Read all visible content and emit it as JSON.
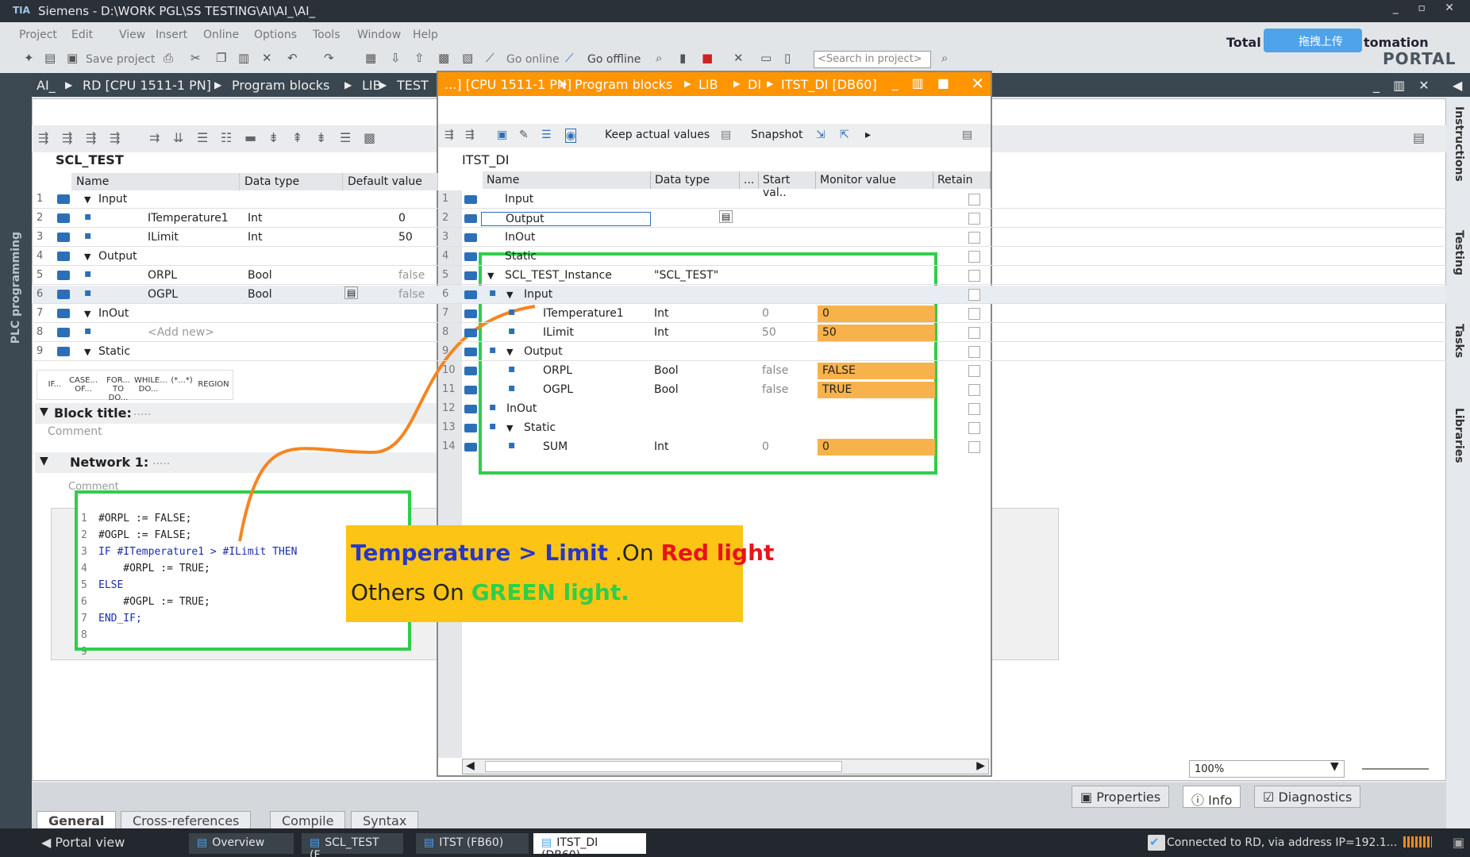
{
  "app": {
    "title": "Siemens  -  D:\\WORK PGL\\SS TESTING\\AI\\AI_\\AI_",
    "logo": "TIA"
  },
  "menu": [
    "Project",
    "Edit",
    "View",
    "Insert",
    "Online",
    "Options",
    "Tools",
    "Window",
    "Help"
  ],
  "toolbar": {
    "save_label": "Save project",
    "go_online": "Go online",
    "go_offline": "Go offline",
    "search_placeholder": "<Search in project>"
  },
  "brand": {
    "total": "Total",
    "portal": "PORTAL",
    "automation": "tomation",
    "upload": "拖拽上传"
  },
  "crumb": [
    "AI_",
    "RD [CPU 1511-1 PN]",
    "Program blocks",
    "LIB",
    "TEST"
  ],
  "plc_label": "PLC programming",
  "block": {
    "name": "SCL_TEST",
    "headers": [
      "Name",
      "Data type",
      "Default value"
    ],
    "rows": [
      {
        "no": "1",
        "name": "Input",
        "type": "",
        "val": "",
        "exp": true,
        "lvl": 0
      },
      {
        "no": "2",
        "name": "ITemperature1",
        "type": "Int",
        "val": "0",
        "lvl": 1
      },
      {
        "no": "3",
        "name": "ILimit",
        "type": "Int",
        "val": "50",
        "lvl": 1
      },
      {
        "no": "4",
        "name": "Output",
        "type": "",
        "val": "",
        "exp": true,
        "lvl": 0
      },
      {
        "no": "5",
        "name": "ORPL",
        "type": "Bool",
        "val": "false",
        "lvl": 1
      },
      {
        "no": "6",
        "name": "OGPL",
        "type": "Bool",
        "val": "false",
        "lvl": 1
      },
      {
        "no": "7",
        "name": "InOut",
        "type": "",
        "val": "",
        "exp": true,
        "lvl": 0
      },
      {
        "no": "8",
        "name": "<Add new>",
        "type": "",
        "val": "",
        "lvl": 1
      },
      {
        "no": "9",
        "name": "Static",
        "type": "",
        "val": "",
        "exp": true,
        "lvl": 0
      }
    ]
  },
  "scl_tools": [
    "IF...",
    "CASE... OF...",
    "FOR... TO DO...",
    "WHILE... DO...",
    "(*...*)",
    "REGION"
  ],
  "block_title": "Block title:",
  "comment": "Comment",
  "network": "Network 1:",
  "dots": ".....",
  "code": [
    [
      "1",
      "#ORPL := FALSE;"
    ],
    [
      "2",
      "#OGPL := FALSE;"
    ],
    [
      "3",
      "IF #ITemperature1 > #ILimit THEN"
    ],
    [
      "4",
      "    #ORPL := TRUE;"
    ],
    [
      "5",
      "ELSE"
    ],
    [
      "6",
      "    #OGPL := TRUE;"
    ],
    [
      "7",
      "END_IF;"
    ],
    [
      "8",
      ""
    ],
    [
      "9",
      ""
    ]
  ],
  "db": {
    "crumb": [
      "...] [CPU 1511-1 PN]",
      "Program blocks",
      "LIB",
      "DI",
      "ITST_DI [DB60]"
    ],
    "name": "ITST_DI",
    "tool": {
      "keep": "Keep actual values",
      "snapshot": "Snapshot"
    },
    "headers": [
      "Name",
      "Data type",
      "...",
      "Start val..",
      "Monitor value",
      "Retain"
    ],
    "rows": [
      {
        "no": "1",
        "name": "Input",
        "lvl": 0
      },
      {
        "no": "2",
        "name": "Output",
        "lvl": 0
      },
      {
        "no": "3",
        "name": "InOut",
        "lvl": 0
      },
      {
        "no": "4",
        "name": "Static",
        "lvl": 0
      },
      {
        "no": "5",
        "name": "SCL_TEST_Instance",
        "type": "\"SCL_TEST\"",
        "lvl": 1,
        "exp": true
      },
      {
        "no": "6",
        "name": "Input",
        "lvl": 2,
        "exp": true
      },
      {
        "no": "7",
        "name": "ITemperature1",
        "type": "Int",
        "start": "0",
        "mon": "0",
        "lvl": 3
      },
      {
        "no": "8",
        "name": "ILimit",
        "type": "Int",
        "start": "50",
        "mon": "50",
        "lvl": 3
      },
      {
        "no": "9",
        "name": "Output",
        "lvl": 2,
        "exp": true
      },
      {
        "no": "10",
        "name": "ORPL",
        "type": "Bool",
        "start": "false",
        "mon": "FALSE",
        "lvl": 3
      },
      {
        "no": "11",
        "name": "OGPL",
        "type": "Bool",
        "start": "false",
        "mon": "TRUE",
        "lvl": 3
      },
      {
        "no": "12",
        "name": "InOut",
        "lvl": 2
      },
      {
        "no": "13",
        "name": "Static",
        "lvl": 2,
        "exp": true
      },
      {
        "no": "14",
        "name": "SUM",
        "type": "Int",
        "start": "0",
        "mon": "0",
        "lvl": 3
      }
    ]
  },
  "callout": {
    "temp": "Temperature",
    "gt": " > ",
    "limit": "Limit",
    "on": " .On ",
    "red": "Red light",
    "others": "Others On ",
    "green": "GREEN light",
    "dot": "."
  },
  "sidebar": [
    "Instructions",
    "Testing",
    "Tasks",
    "Libraries"
  ],
  "zoom": "100%",
  "inspector": {
    "properties": "Properties",
    "info": "Info",
    "diagnostics": "Diagnostics"
  },
  "subtabs": [
    "General",
    "Cross-references",
    "Compile",
    "Syntax"
  ],
  "taskbar": {
    "portal": "Portal view",
    "items": [
      "Overview",
      "SCL_TEST (F...",
      "ITST (FB60)",
      "ITST_DI (DB60)"
    ],
    "status": "Connected to RD, via address IP=192.1..."
  }
}
